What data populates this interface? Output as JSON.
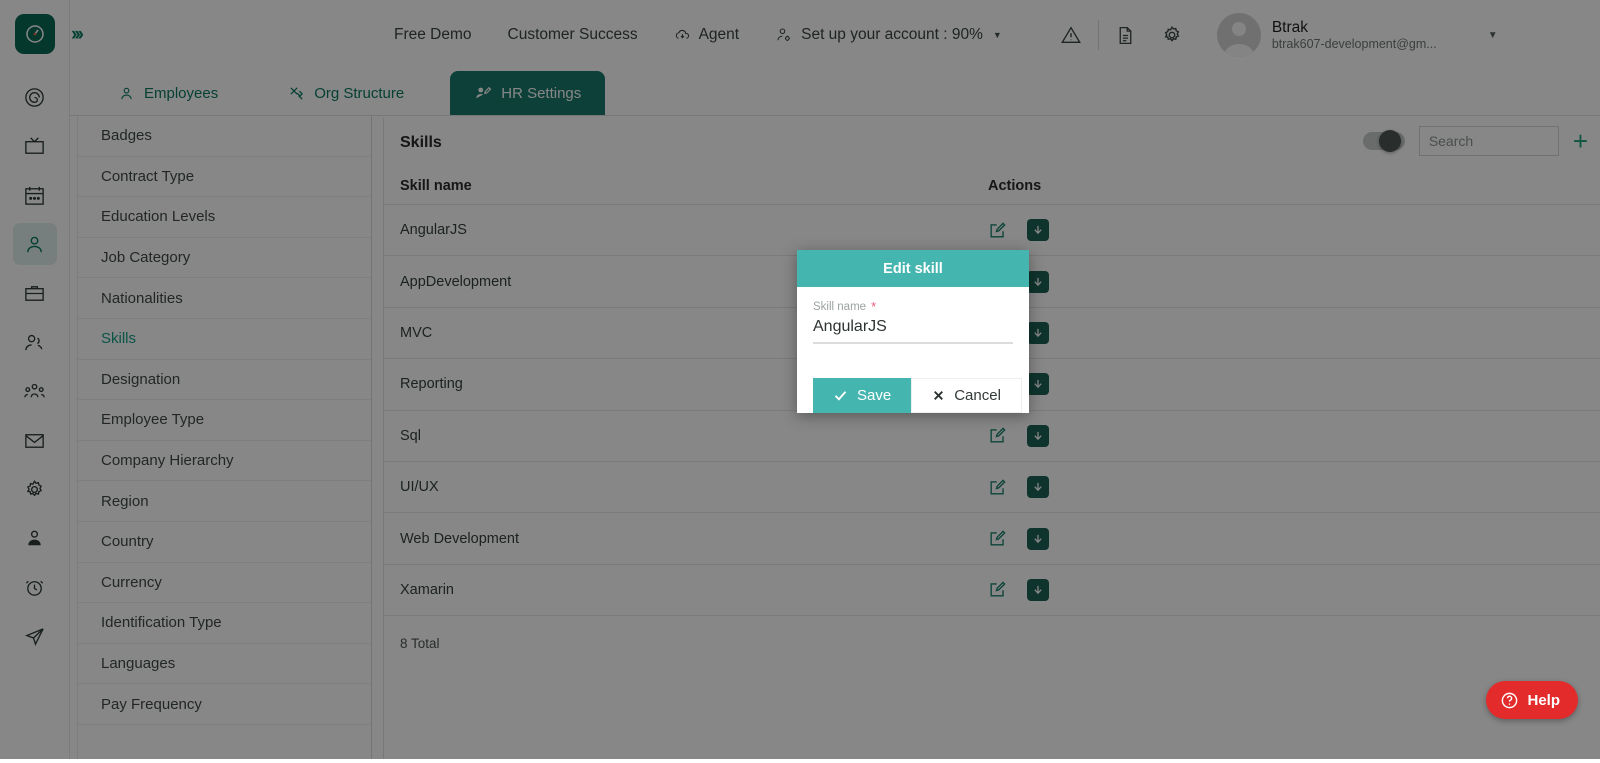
{
  "brand": {
    "accent": "#16a085",
    "teal": "#45b5af",
    "dark_green": "#17796a",
    "help_red": "#e32b2b"
  },
  "rail": {
    "logo_icon": "clock-logo-icon",
    "expand_icon": "chevrons-right-icon",
    "items": [
      {
        "name": "dashboard-icon",
        "icon": "spiral-target-icon",
        "active": false
      },
      {
        "name": "announcements-icon",
        "icon": "tv-icon",
        "active": false
      },
      {
        "name": "calendar-icon",
        "icon": "calendar-icon",
        "active": false
      },
      {
        "name": "employees-icon",
        "icon": "person-icon",
        "active": true
      },
      {
        "name": "jobs-icon",
        "icon": "briefcase-icon",
        "active": false
      },
      {
        "name": "recruitment-icon",
        "icon": "people-icon",
        "active": false
      },
      {
        "name": "teams-icon",
        "icon": "group-icon",
        "active": false
      },
      {
        "name": "mail-icon",
        "icon": "envelope-icon",
        "active": false
      },
      {
        "name": "settings-icon",
        "icon": "gear-icon",
        "active": false
      },
      {
        "name": "profile-icon",
        "icon": "user-badge-icon",
        "active": false
      },
      {
        "name": "timesheet-icon",
        "icon": "alarm-clock-icon",
        "active": false
      },
      {
        "name": "send-icon",
        "icon": "paper-plane-icon",
        "active": false
      }
    ]
  },
  "header": {
    "nav": [
      {
        "label": "Free Demo",
        "icon": null,
        "caret": false
      },
      {
        "label": "Customer Success",
        "icon": null,
        "caret": false
      },
      {
        "label": "Agent",
        "icon": "cloud-download-icon",
        "caret": false
      },
      {
        "label": "Set up your account : 90%",
        "icon": "user-setup-icon",
        "caret": true
      }
    ],
    "icons": [
      {
        "name": "warning-icon"
      },
      {
        "name": "document-icon"
      },
      {
        "name": "gear-icon"
      }
    ],
    "profile": {
      "name": "Btrak",
      "email": "btrak607-development@gm...",
      "avatar": "avatar-placeholder-icon",
      "caret": "chevron-down-icon"
    }
  },
  "tabs": [
    {
      "label": "Employees",
      "icon": "person-icon",
      "active": false
    },
    {
      "label": "Org Structure",
      "icon": "tools-icon",
      "active": false
    },
    {
      "label": "HR Settings",
      "icon": "user-edit-icon",
      "active": true
    }
  ],
  "settings_nav": {
    "items": [
      {
        "label": "Badges",
        "active": false
      },
      {
        "label": "Contract Type",
        "active": false
      },
      {
        "label": "Education Levels",
        "active": false
      },
      {
        "label": "Job Category",
        "active": false
      },
      {
        "label": "Nationalities",
        "active": false
      },
      {
        "label": "Skills",
        "active": true
      },
      {
        "label": "Designation",
        "active": false
      },
      {
        "label": "Employee Type",
        "active": false
      },
      {
        "label": "Company Hierarchy",
        "active": false
      },
      {
        "label": "Region",
        "active": false
      },
      {
        "label": "Country",
        "active": false
      },
      {
        "label": "Currency",
        "active": false
      },
      {
        "label": "Identification Type",
        "active": false
      },
      {
        "label": "Languages",
        "active": false
      },
      {
        "label": "Pay Frequency",
        "active": false
      }
    ]
  },
  "content": {
    "title": "Skills",
    "toggle": {
      "name": "show-inactive-toggle",
      "state": "off"
    },
    "search": {
      "placeholder": "Search",
      "value": ""
    },
    "add_button": "+",
    "columns": [
      "Skill name",
      "Actions"
    ],
    "rows": [
      {
        "skill_name": "AngularJS"
      },
      {
        "skill_name": "AppDevelopment"
      },
      {
        "skill_name": "MVC"
      },
      {
        "skill_name": "Reporting"
      },
      {
        "skill_name": "Sql"
      },
      {
        "skill_name": "UI/UX"
      },
      {
        "skill_name": "Web Development"
      },
      {
        "skill_name": "Xamarin"
      }
    ],
    "row_actions": {
      "edit": "edit-icon",
      "archive": "archive-down-icon"
    },
    "footer_total": "8 Total"
  },
  "modal": {
    "title": "Edit skill",
    "field_label": "Skill name",
    "required_marker": "*",
    "field_value": "AngularJS",
    "save_label": "Save",
    "cancel_label": "Cancel"
  },
  "help": {
    "label": "Help",
    "icon": "question-circle-icon"
  }
}
